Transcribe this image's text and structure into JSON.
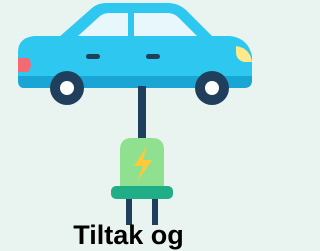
{
  "caption": "Tiltak og",
  "icons": {
    "car": "electric-car-icon",
    "plug": "charging-plug-icon",
    "bolt": "lightning-bolt-icon"
  },
  "colors": {
    "background": "#e9f3ef",
    "car_body": "#2ec7ef",
    "car_body_shadow": "#1aa6d4",
    "window": "#e7f7fb",
    "wheel_outer": "#1f3f5c",
    "wheel_inner": "#ffffff",
    "headlight": "#ffe98a",
    "tail_light": "#f36a74",
    "cable": "#1f3f5c",
    "plug_head": "#8fe08f",
    "plug_base": "#1fae86",
    "bolt": "#ffc93a",
    "caption_text": "#000000"
  }
}
